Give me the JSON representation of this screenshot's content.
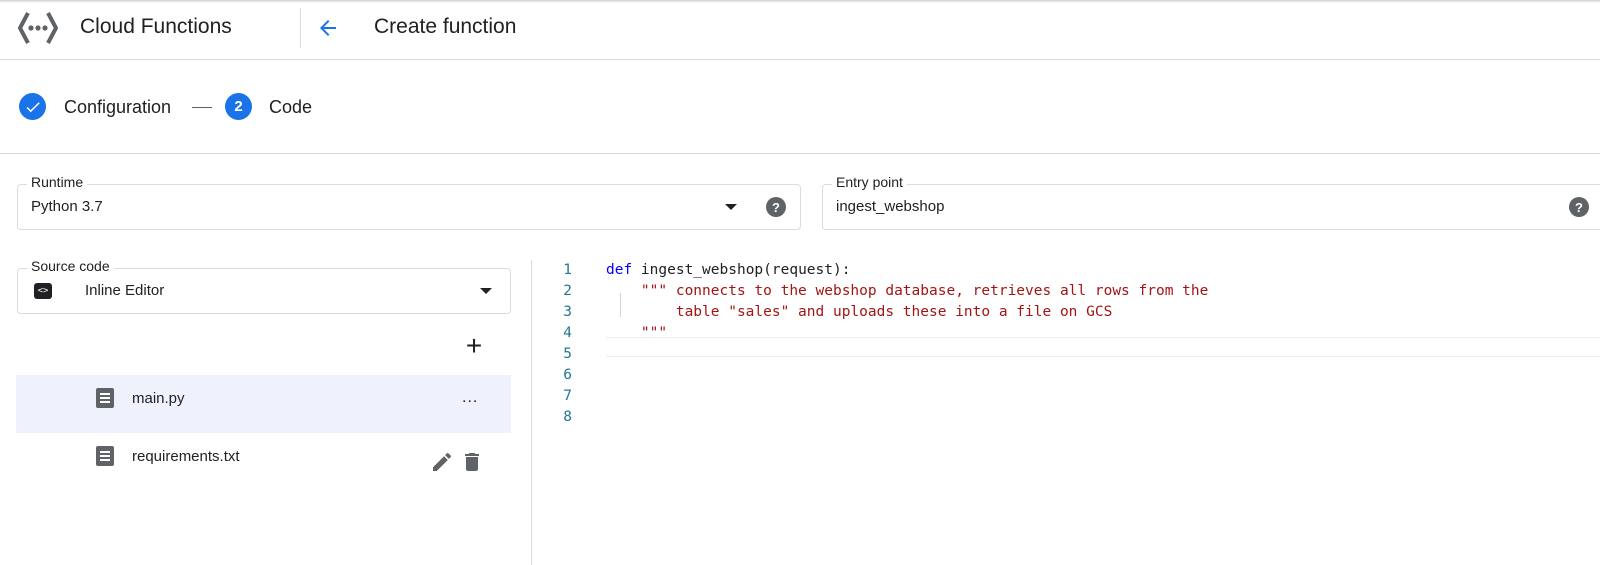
{
  "header": {
    "app_title": "Cloud Functions",
    "page_title": "Create function",
    "logo_icon": "cloud-functions-logo",
    "back_icon": "arrow-back-icon"
  },
  "stepper": {
    "step1": {
      "label": "Configuration",
      "state": "complete"
    },
    "step2": {
      "label": "Code",
      "number": "2",
      "state": "active"
    }
  },
  "runtime": {
    "label": "Runtime",
    "value": "Python 3.7"
  },
  "entry_point": {
    "label": "Entry point",
    "value": "ingest_webshop"
  },
  "help_glyph": "?",
  "source_code": {
    "label": "Source code",
    "value": "Inline Editor",
    "badge": "<>"
  },
  "files": [
    {
      "name": "main.py",
      "selected": true,
      "actions": [
        "more"
      ]
    },
    {
      "name": "requirements.txt",
      "selected": false,
      "actions": [
        "edit",
        "delete"
      ]
    }
  ],
  "more_glyph": "...",
  "add_glyph": "+",
  "editor": {
    "line_numbers": [
      "1",
      "2",
      "3",
      "4",
      "5",
      "6",
      "7",
      "8"
    ],
    "lines": [
      {
        "kw": "def",
        "rest": " ingest_webshop(request):"
      },
      {
        "str": "    \"\"\" connects to the webshop database, retrieves all rows from the"
      },
      {
        "str": "        table \"sales\" and uploads these into a file on GCS"
      },
      {
        "str": "    \"\"\""
      }
    ]
  },
  "colors": {
    "accent": "#1a73e8",
    "keyword": "#0000ff",
    "string": "#a31515",
    "line_number": "#237893",
    "selected_row": "#eef2fc"
  }
}
